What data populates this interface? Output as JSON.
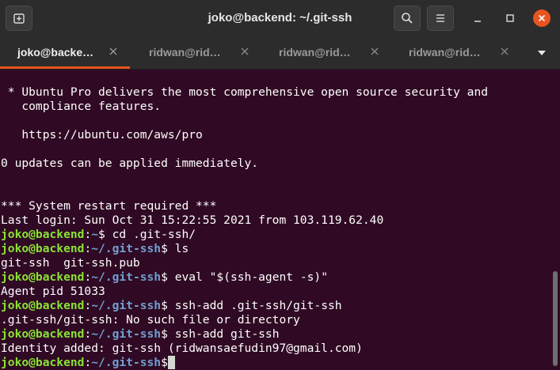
{
  "window": {
    "title": "joko@backend: ~/.git-ssh"
  },
  "header_icons": {
    "new_tab": "new-tab-icon",
    "search": "search-icon",
    "menu": "hamburger-menu-icon",
    "minimize": "minimize-icon",
    "maximize": "maximize-icon",
    "close": "close-icon"
  },
  "colors": {
    "accent": "#e95420",
    "terminal_bg": "#300a24",
    "prompt_user": "#8ae234",
    "prompt_path": "#729fcf"
  },
  "tabs": [
    {
      "label": "joko@backe…",
      "active": true
    },
    {
      "label": "ridwan@rid…",
      "active": false
    },
    {
      "label": "ridwan@rid…",
      "active": false
    },
    {
      "label": "ridwan@rid…",
      "active": false
    }
  ],
  "terminal": {
    "lines": [
      {
        "text": " * Ubuntu Pro delivers the most comprehensive open source security and"
      },
      {
        "text": "   compliance features."
      },
      {
        "text": ""
      },
      {
        "text": "   https://ubuntu.com/aws/pro"
      },
      {
        "text": ""
      },
      {
        "text": "0 updates can be applied immediately."
      },
      {
        "text": ""
      },
      {
        "text": ""
      },
      {
        "text": "*** System restart required ***"
      },
      {
        "text": "Last login: Sun Oct 31 15:22:55 2021 from 103.119.62.40"
      },
      {
        "prompt": {
          "user": "joko@backend",
          "colon": ":",
          "path": "~",
          "dollar": "$"
        },
        "cmd": " cd .git-ssh/"
      },
      {
        "prompt": {
          "user": "joko@backend",
          "colon": ":",
          "path": "~/.git-ssh",
          "dollar": "$"
        },
        "cmd": " ls"
      },
      {
        "text": "git-ssh  git-ssh.pub"
      },
      {
        "prompt": {
          "user": "joko@backend",
          "colon": ":",
          "path": "~/.git-ssh",
          "dollar": "$"
        },
        "cmd": " eval \"$(ssh-agent -s)\""
      },
      {
        "text": "Agent pid 51033"
      },
      {
        "prompt": {
          "user": "joko@backend",
          "colon": ":",
          "path": "~/.git-ssh",
          "dollar": "$"
        },
        "cmd": " ssh-add .git-ssh/git-ssh"
      },
      {
        "text": ".git-ssh/git-ssh: No such file or directory"
      },
      {
        "prompt": {
          "user": "joko@backend",
          "colon": ":",
          "path": "~/.git-ssh",
          "dollar": "$"
        },
        "cmd": " ssh-add git-ssh"
      },
      {
        "text": "Identity added: git-ssh (ridwansaefudin97@gmail.com)"
      },
      {
        "prompt": {
          "user": "joko@backend",
          "colon": ":",
          "path": "~/.git-ssh",
          "dollar": "$"
        },
        "cmd": "",
        "cursor": true
      }
    ]
  }
}
